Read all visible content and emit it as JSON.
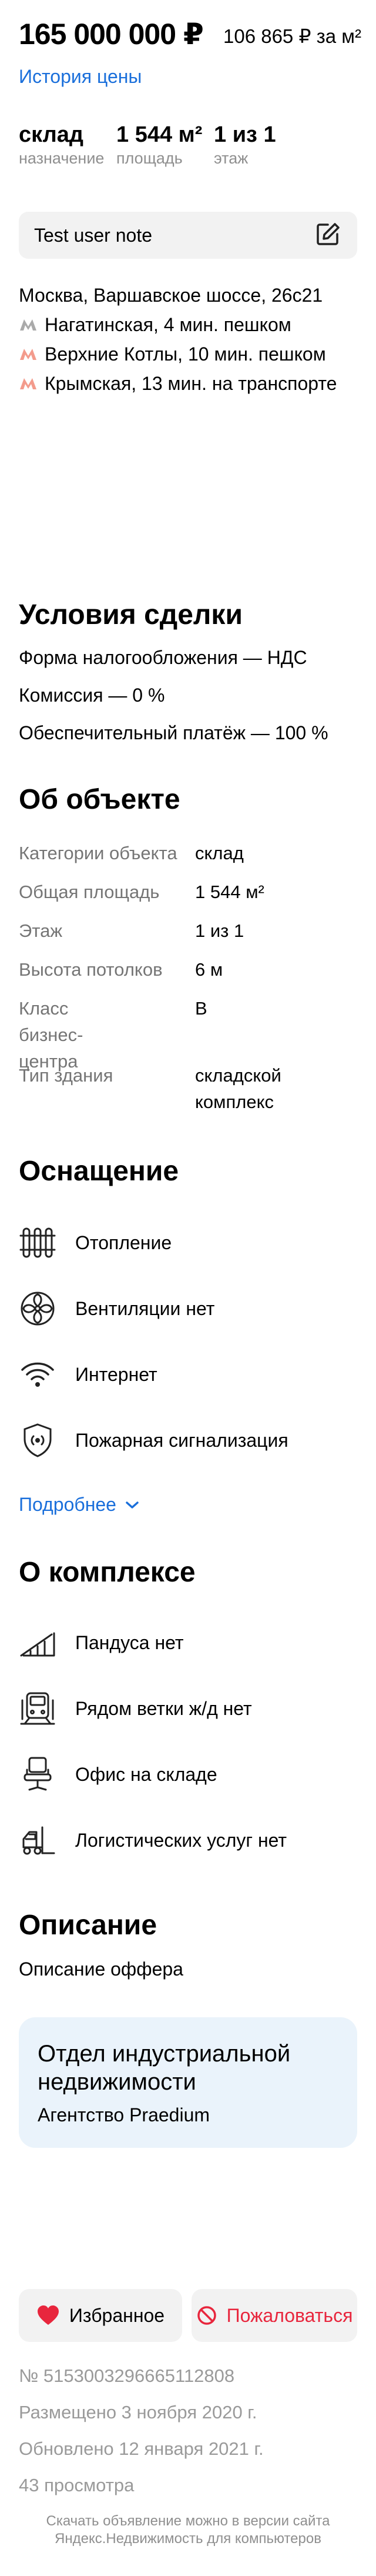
{
  "price": {
    "total": "165 000 000 ₽",
    "per_m2": "106 865 ₽ за м²",
    "history_link": "История цены"
  },
  "stats": [
    {
      "value": "склад",
      "label": "назначение"
    },
    {
      "value": "1 544 м²",
      "label": "площадь"
    },
    {
      "value": "1 из 1",
      "label": "этаж"
    }
  ],
  "note": {
    "text": "Test user note",
    "edit_icon": "edit-icon"
  },
  "address": "Москва, Варшавское шоссе, 26с21",
  "metro": [
    {
      "text": "Нагатинская, 4 мин. пешком",
      "color": "#aaaaaa"
    },
    {
      "text": "Верхние Котлы, 10 мин. пешком",
      "color": "#f39b8c"
    },
    {
      "text": "Крымская, 13 мин. на транспорте",
      "color": "#f39b8c"
    }
  ],
  "deal": {
    "title": "Условия сделки",
    "lines": [
      "Форма налогообложения — НДС",
      "Комиссия — 0 %",
      "Обеспечительный платёж — 100 %"
    ]
  },
  "object": {
    "title": "Об объекте",
    "rows": [
      {
        "key": "Категории объекта",
        "value": "склад"
      },
      {
        "key": "Общая площадь",
        "value": "1 544 м²"
      },
      {
        "key": "Этаж",
        "value": "1 из 1"
      },
      {
        "key": "Высота потолков",
        "value": "6 м"
      },
      {
        "key": "Класс бизнес-центра",
        "value": "B"
      },
      {
        "key": "Тип здания",
        "value": "складской комплекс"
      }
    ]
  },
  "equipment": {
    "title": "Оснащение",
    "items": [
      {
        "icon": "radiator-icon",
        "label": "Отопление"
      },
      {
        "icon": "fan-icon",
        "label": "Вентиляции нет"
      },
      {
        "icon": "wifi-icon",
        "label": "Интернет"
      },
      {
        "icon": "fire-alarm-icon",
        "label": "Пожарная сигнализация"
      }
    ],
    "more": "Подробнее"
  },
  "complex": {
    "title": "О комплексе",
    "items": [
      {
        "icon": "ramp-icon",
        "label": "Пандуса нет"
      },
      {
        "icon": "train-icon",
        "label": "Рядом ветки ж/д нет"
      },
      {
        "icon": "office-chair-icon",
        "label": "Офис на складе"
      },
      {
        "icon": "forklift-icon",
        "label": "Логистических услуг нет"
      }
    ]
  },
  "description": {
    "title": "Описание",
    "text": "Описание оффера"
  },
  "agent": {
    "title": "Отдел индустриальной недвижимости",
    "agency": "Агентство Praedium"
  },
  "actions": {
    "favorite": "Избранное",
    "complain": "Пожаловаться",
    "favorite_color": "#e8263d",
    "complain_color": "#e8263d"
  },
  "meta": {
    "number": "№ 5153003296665112808",
    "posted": "Размещено 3 ноября 2020 г.",
    "updated": "Обновлено 12 января 2021 г.",
    "views": "43 просмотра"
  },
  "footer": {
    "line1": "Скачать объявление можно в версии сайта",
    "line2": "Яндекс.Недвижимость для компьютеров"
  }
}
